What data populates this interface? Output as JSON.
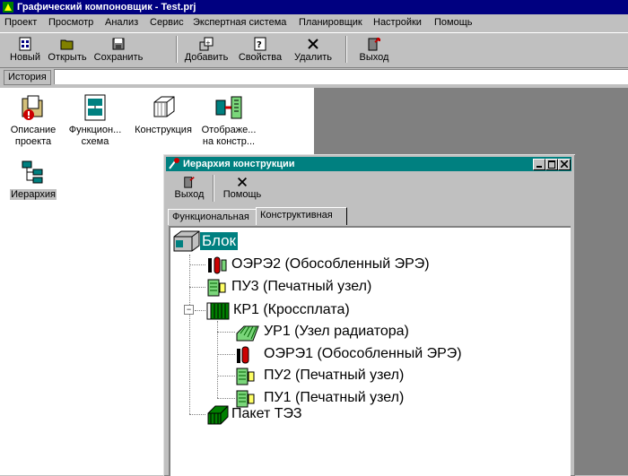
{
  "app": {
    "title": "Графический компоновщик - Test.prj"
  },
  "menu": [
    "Проект",
    "Просмотр",
    "Анализ",
    "Сервис",
    "Экспертная система",
    "Планировщик",
    "Настройки",
    "Помощь"
  ],
  "toolbar": {
    "new": "Новый",
    "open": "Открыть",
    "save": "Сохранить",
    "add": "Добавить",
    "properties": "Свойства",
    "delete": "Удалить",
    "exit": "Выход"
  },
  "history": {
    "label": "История",
    "value": ""
  },
  "project_items": [
    {
      "label": "Описание\nпроекта",
      "icon": "project-description-icon"
    },
    {
      "label": "Функцион...\nсхема",
      "icon": "functional-scheme-icon"
    },
    {
      "label": "Конструкция",
      "icon": "construction-icon"
    },
    {
      "label": "Отображе...\nна констр...",
      "icon": "mapping-icon"
    },
    {
      "label": "Иерархия",
      "icon": "hierarchy-icon"
    }
  ],
  "hierarchy_window": {
    "title": "Иерархия конструкции",
    "exit": "Выход",
    "help": "Помощь",
    "tabs": [
      "Функциональная",
      "Конструктивная"
    ],
    "active_tab": "Конструктивная"
  },
  "tree": {
    "root": "Блок",
    "n1": "ОЭРЭ2 (Обособленный ЭРЭ)",
    "n2": "ПУ3 (Печатный узел)",
    "n3": "КР1 (Кроссплата)",
    "n3_1": "УР1 (Узел радиатора)",
    "n3_2": "ОЭРЭ1 (Обособленный ЭРЭ)",
    "n3_3": "ПУ2 (Печатный узел)",
    "n3_4": "ПУ1 (Печатный узел)",
    "n4": "Пакет ТЭЗ",
    "expander_symbol": "−"
  },
  "colors": {
    "title_active": "#000080",
    "title_child": "#008080",
    "face": "#c0c0c0",
    "desktop": "#808080"
  }
}
